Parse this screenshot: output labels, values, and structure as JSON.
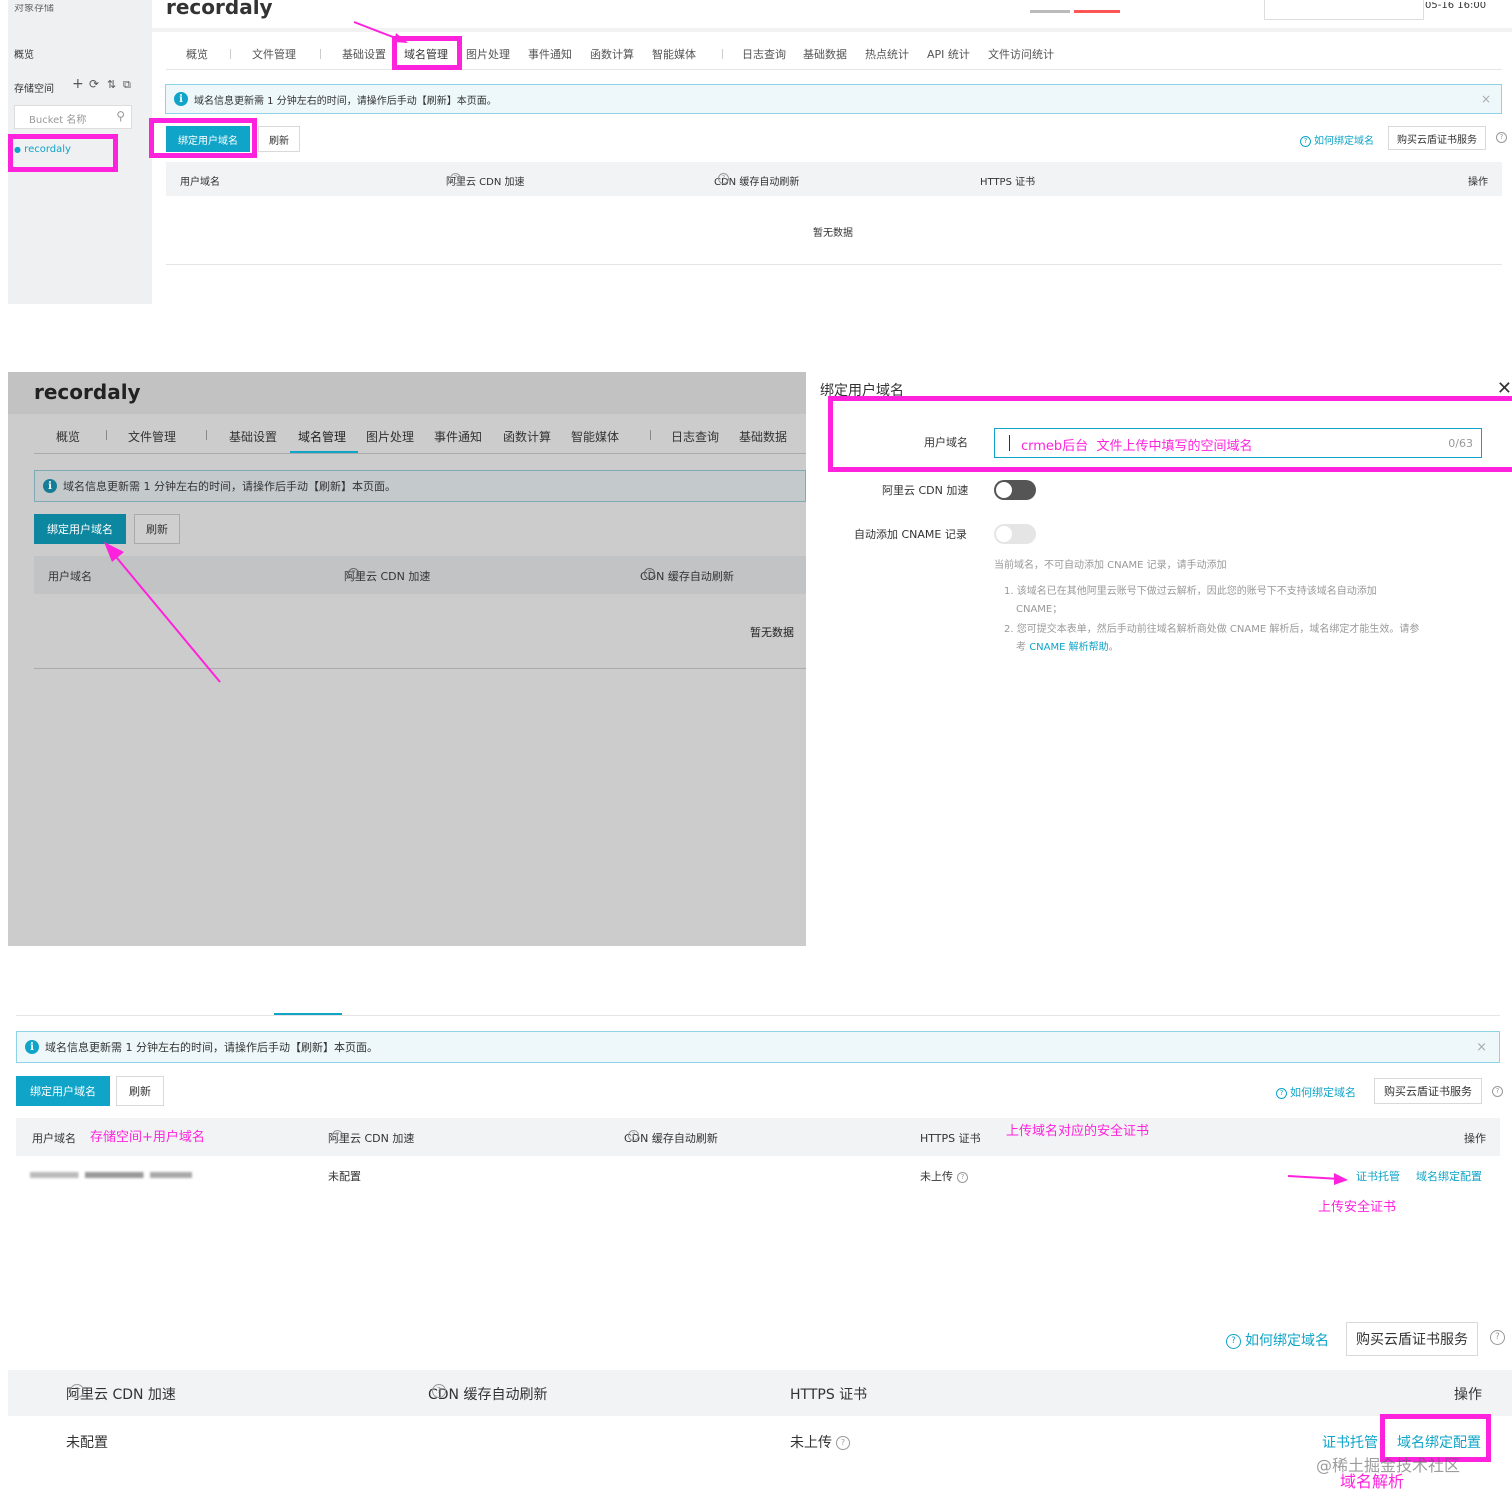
{
  "colors": {
    "accent": "#0fa4c8",
    "annotation": "#ff22dd",
    "info_bg": "#eef8fb"
  },
  "p1": {
    "top_title": "recordaly",
    "top_left_clip": "对象存储",
    "top_right_clip": "05-16 16:00",
    "sidebar": {
      "overview": "概览",
      "storage": "存储空间",
      "search_placeholder": "Bucket 名称",
      "bucket": "recordaly"
    },
    "tabs": [
      "概览",
      "文件管理",
      "基础设置",
      "域名管理",
      "图片处理",
      "事件通知",
      "函数计算",
      "智能媒体",
      "日志查询",
      "基础数据",
      "热点统计",
      "API 统计",
      "文件访问统计"
    ],
    "info": "域名信息更新需 1 分钟左右的时间，请操作后手动【刷新】本页面。",
    "bind_btn": "绑定用户域名",
    "refresh_btn": "刷新",
    "how_link": "如何绑定域名",
    "buy_btn": "购买云盾证书服务",
    "cols": [
      "用户域名",
      "阿里云 CDN 加速",
      "CDN 缓存自动刷新",
      "HTTPS 证书",
      "操作"
    ],
    "empty": "暂无数据"
  },
  "p2": {
    "title": "recordaly",
    "tabs": [
      "概览",
      "文件管理",
      "基础设置",
      "域名管理",
      "图片处理",
      "事件通知",
      "函数计算",
      "智能媒体",
      "日志查询",
      "基础数据"
    ],
    "info": "域名信息更新需 1 分钟左右的时间，请操作后手动【刷新】本页面。",
    "bind_btn": "绑定用户域名",
    "refresh_btn": "刷新",
    "cols": [
      "用户域名",
      "阿里云 CDN 加速",
      "CDN 缓存自动刷新"
    ],
    "empty": "暂无数据",
    "dialog": {
      "title": "绑定用户域名",
      "domain_label": "用户域名",
      "domain_value": "crmeb后台  文件上传中填写的空间域名",
      "counter": "0/63",
      "cdn_label": "阿里云 CDN 加速",
      "cname_label": "自动添加 CNAME 记录",
      "hint": "当前域名，不可自动添加 CNAME 记录，请手动添加",
      "note1": "1. 该域名已在其他阿里云账号下做过云解析，因此您的账号下不支持该域名自动添加",
      "note1b": "CNAME；",
      "note2": "2. 您可提交本表单，然后手动前往域名解析商处做 CNAME 解析后，域名绑定才能生效。请参",
      "note2b_pre": "考",
      "note2b_link": "CNAME 解析帮助",
      "note2b_post": "。"
    }
  },
  "p3": {
    "info": "域名信息更新需 1 分钟左右的时间，请操作后手动【刷新】本页面。",
    "bind_btn": "绑定用户域名",
    "refresh_btn": "刷新",
    "how_link": "如何绑定域名",
    "buy_btn": "购买云盾证书服务",
    "cols": [
      "用户域名",
      "阿里云 CDN 加速",
      "CDN 缓存自动刷新",
      "HTTPS 证书",
      "操作"
    ],
    "row": {
      "cdn": "未配置",
      "https": "未上传",
      "cert_link": "证书托管",
      "config_link": "域名绑定配置"
    },
    "annotations": {
      "domain": "存储空间+用户域名",
      "cert": "上传域名对应的安全证书",
      "upload": "上传安全证书"
    }
  },
  "p4": {
    "how_link": "如何绑定域名",
    "buy_btn": "购买云盾证书服务",
    "cols": [
      "阿里云 CDN 加速",
      "CDN 缓存自动刷新",
      "HTTPS 证书",
      "操作"
    ],
    "row": {
      "cdn": "未配置",
      "https": "未上传",
      "cert_link": "证书托管",
      "config_link": "域名绑定配置"
    },
    "watermark": "@稀土掘金技术社区",
    "annotation": "域名解析"
  }
}
